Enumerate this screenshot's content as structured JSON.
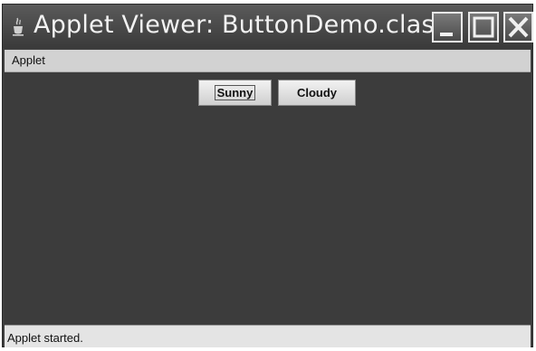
{
  "window": {
    "title": "Applet Viewer: ButtonDemo.class",
    "icon": "java-cup-icon",
    "controls": [
      "minimize-icon",
      "maximize-icon",
      "close-icon"
    ]
  },
  "menubar": {
    "items": [
      {
        "label": "Applet"
      }
    ]
  },
  "applet": {
    "buttons": [
      {
        "label": "Sunny",
        "focused": true
      },
      {
        "label": "Cloudy",
        "focused": false
      }
    ]
  },
  "status": {
    "text": "Applet started."
  },
  "colors": {
    "content_background": "#3c3c3c",
    "titlebar": "#4a4a4a",
    "menubar": "#d2d2d2",
    "statusbar": "#e4e4e4"
  }
}
